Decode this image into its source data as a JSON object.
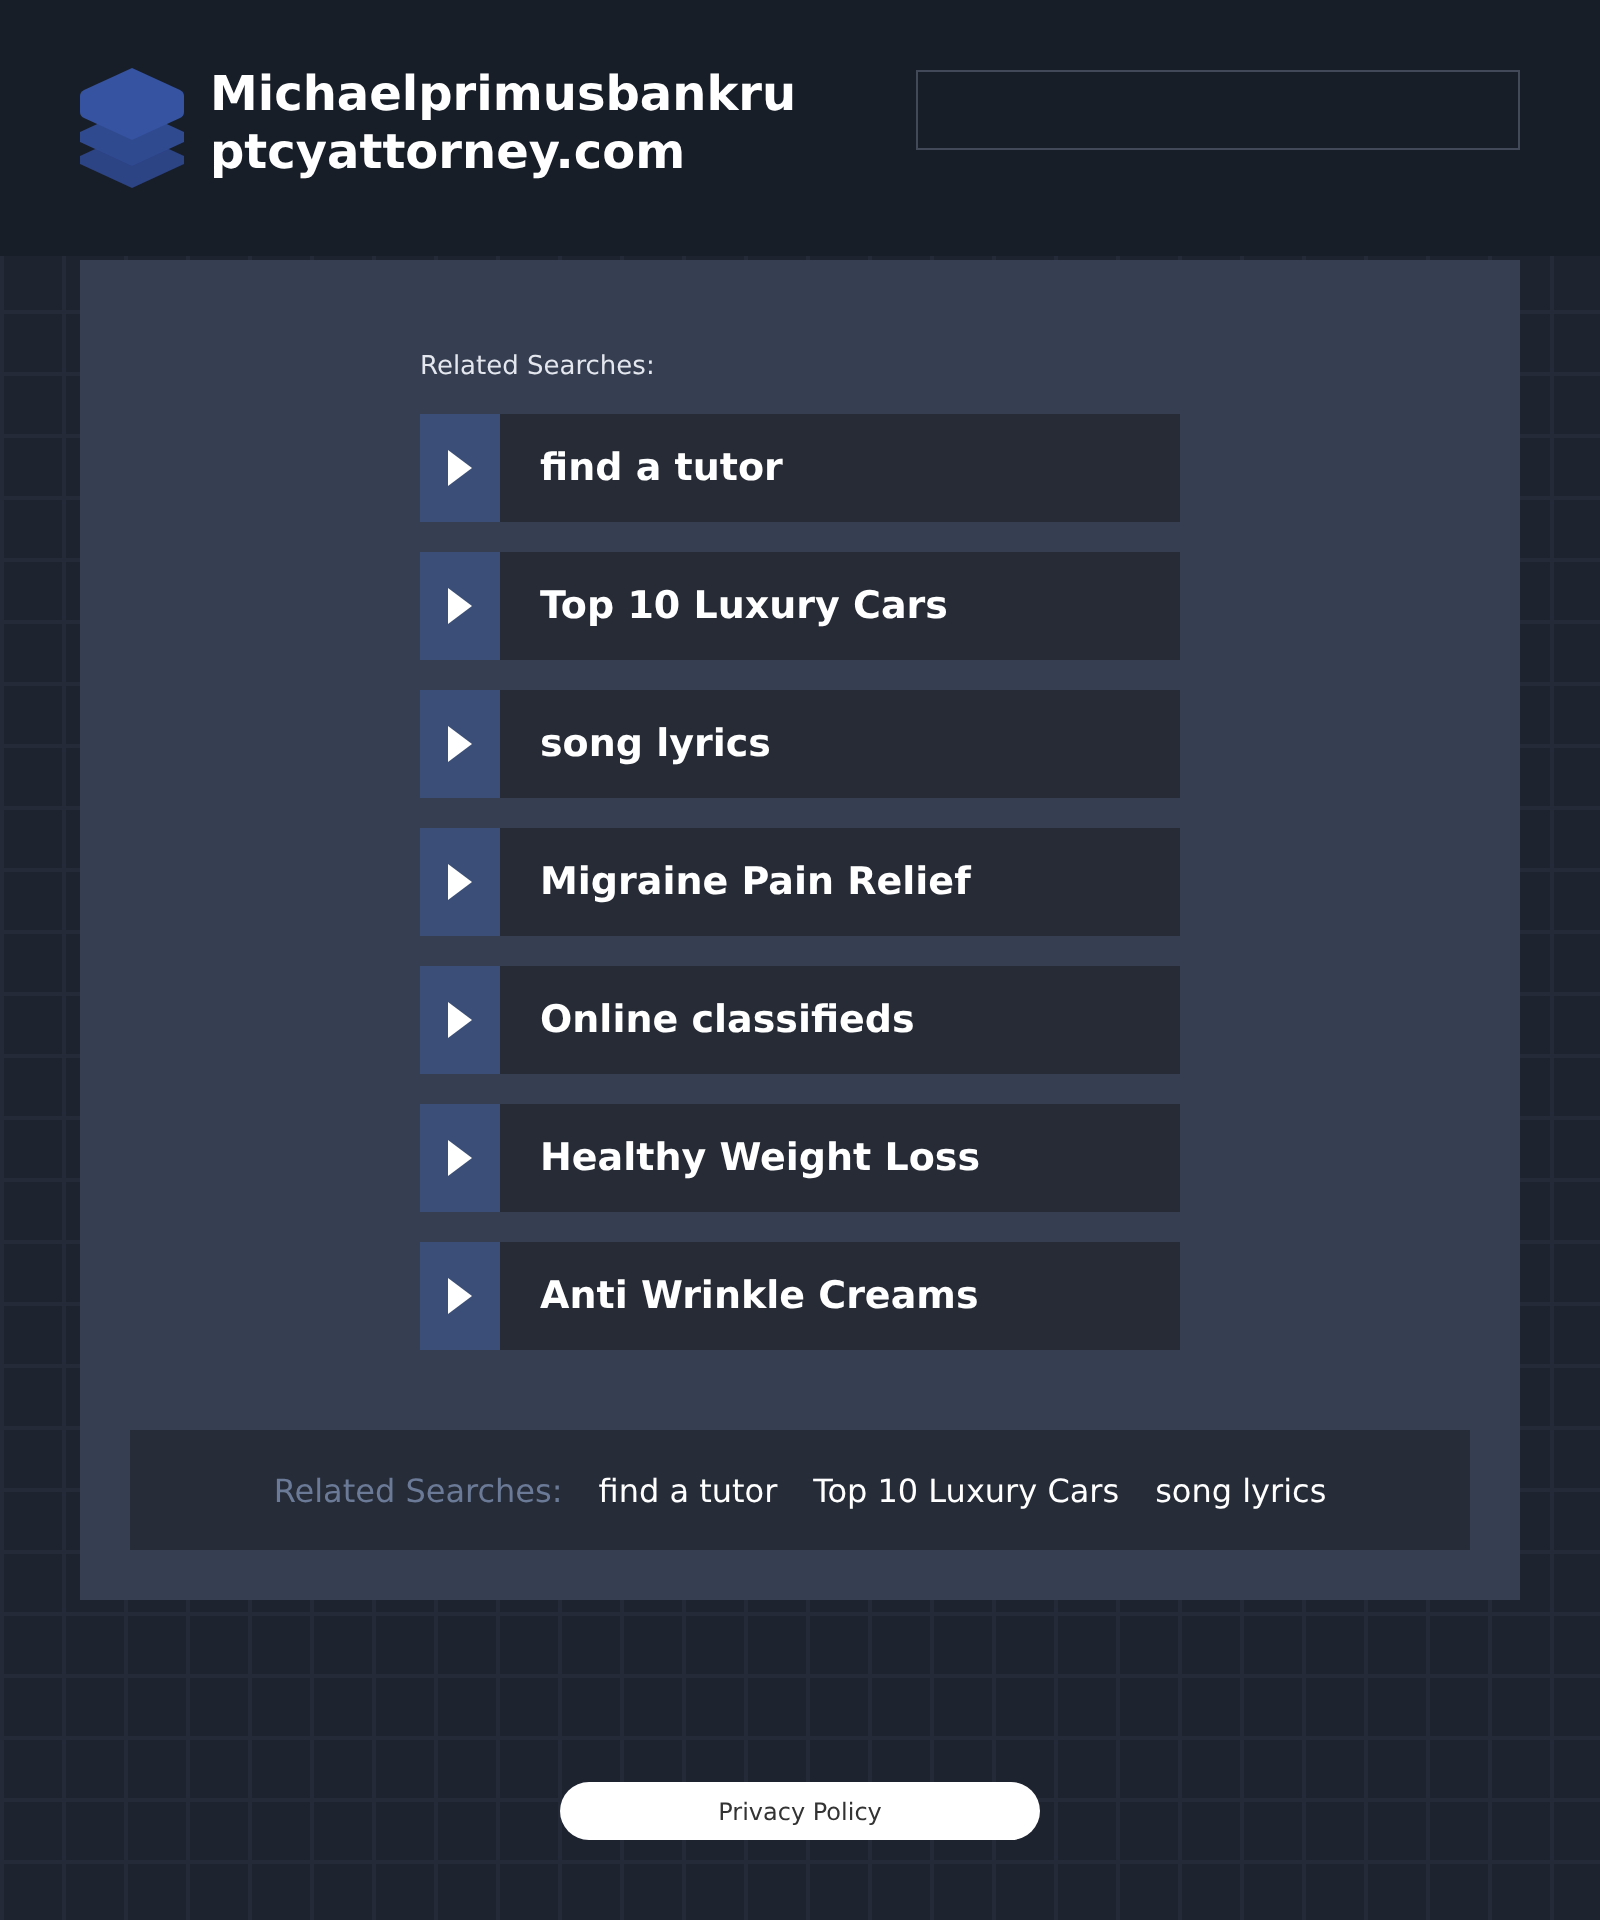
{
  "header": {
    "site_title": "Michaelprimusbankruptcyattorney.com"
  },
  "related_searches": {
    "label": "Related Searches:",
    "items": [
      "find a tutor",
      "Top 10 Luxury Cars",
      "song lyrics",
      "Migraine Pain Relief",
      "Online classifieds",
      "Healthy Weight Loss",
      "Anti Wrinkle Creams"
    ]
  },
  "footer_searches": {
    "label": "Related Searches:",
    "links": [
      "find a tutor",
      "Top 10 Luxury Cars",
      "song lyrics"
    ]
  },
  "privacy_link": "Privacy Policy"
}
